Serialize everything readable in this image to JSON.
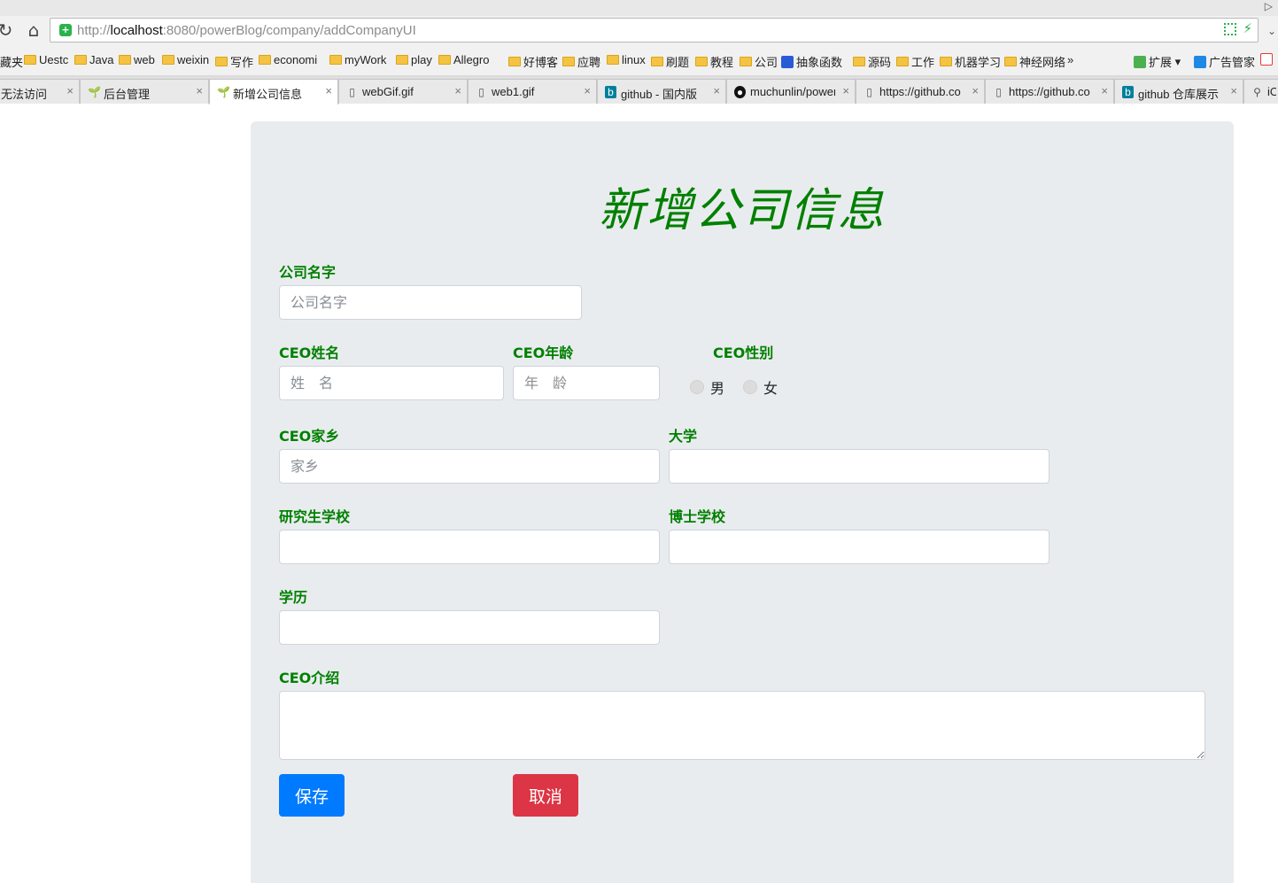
{
  "browser": {
    "url_prefix": "http://",
    "url_host": "localhost",
    "url_rest": ":8080/powerBlog/company/addCompanyUI",
    "bookmarks": [
      "藏夹",
      "Uestc",
      "Java",
      "web",
      "weixin",
      "写作",
      "economi",
      "myWork",
      "play",
      "Allegro",
      "好博客",
      "应聘",
      "linux",
      "刷题",
      "教程",
      "公司",
      "抽象函数",
      "源码",
      "工作",
      "机器学习",
      "神经网络"
    ],
    "bookmarks_more": "»",
    "extensions_label": "扩展",
    "adblock_label": "广告管家",
    "tabs": [
      {
        "label": "无法访问"
      },
      {
        "label": "后台管理"
      },
      {
        "label": "新增公司信息"
      },
      {
        "label": "webGif.gif"
      },
      {
        "label": "web1.gif"
      },
      {
        "label": "github - 国内版"
      },
      {
        "label": "muchunlin/power"
      },
      {
        "label": "https://github.co"
      },
      {
        "label": "https://github.co"
      },
      {
        "label": "github 仓库展示"
      },
      {
        "label": "iO"
      }
    ],
    "tab_close": "×"
  },
  "form": {
    "title": "新增公司信息",
    "company_name": {
      "label": "公司名字",
      "placeholder": "公司名字"
    },
    "ceo_name": {
      "label": "CEO姓名",
      "placeholder": "姓　名"
    },
    "ceo_age": {
      "label": "CEO年龄",
      "placeholder": "年　龄"
    },
    "ceo_gender": {
      "label": "CEO性别",
      "options": [
        "男",
        "女"
      ]
    },
    "ceo_hometown": {
      "label": "CEO家乡",
      "placeholder": "家乡"
    },
    "university": {
      "label": "大学",
      "placeholder": ""
    },
    "graduate_school": {
      "label": "研究生学校",
      "placeholder": ""
    },
    "phd_school": {
      "label": "博士学校",
      "placeholder": ""
    },
    "education": {
      "label": "学历",
      "placeholder": ""
    },
    "ceo_intro": {
      "label": "CEO介绍",
      "placeholder": ""
    },
    "save_label": "保存",
    "cancel_label": "取消"
  },
  "colors": {
    "label_green": "#008000",
    "panel_bg": "#e9ecef",
    "save_blue": "#007bff",
    "cancel_red": "#dc3545"
  }
}
